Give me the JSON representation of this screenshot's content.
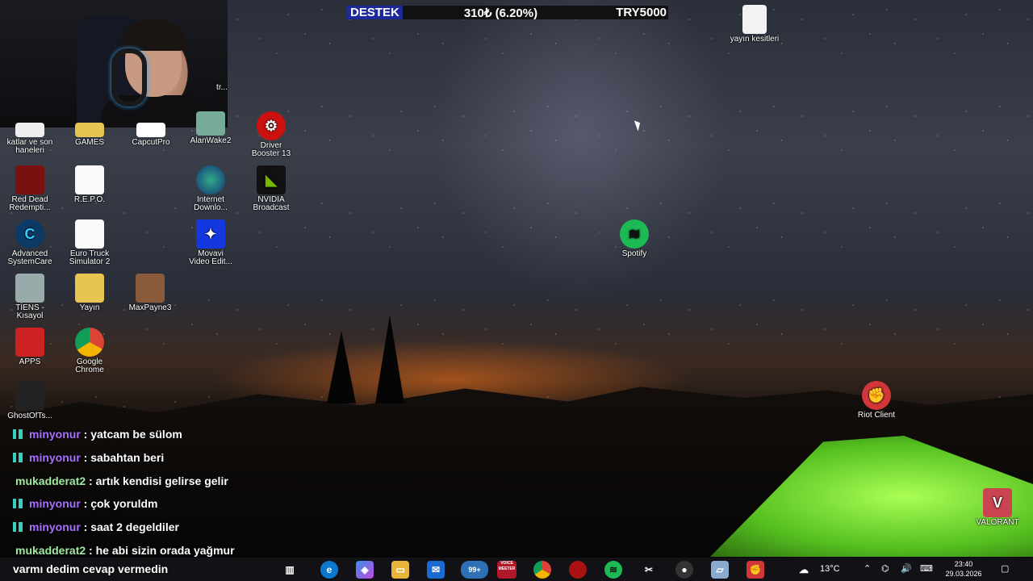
{
  "support_bar": {
    "label": "DESTEK",
    "amount": "310₺ (6.20%)",
    "goal": "TRY5000"
  },
  "desktop_icons": [
    {
      "label": "katlar ve son\nhaneleri"
    },
    {
      "label": "GAMES"
    },
    {
      "label": "CapcutPro"
    },
    {
      "label": "AlanWake2"
    },
    {
      "label": "Driver\nBooster 13"
    },
    {
      "label": "Red Dead\nRedempti..."
    },
    {
      "label": "R.E.P.O."
    },
    {
      "label": "Internet\nDownlo..."
    },
    {
      "label": "NVIDIA\nBroadcast"
    },
    {
      "label": "Advanced\nSystemCare"
    },
    {
      "label": "Euro Truck\nSimulator 2"
    },
    {
      "label": "Movavi\nVideo Edit..."
    },
    {
      "label": "TİENS -\nKısayol"
    },
    {
      "label": "Yayın"
    },
    {
      "label": "MaxPayne3"
    },
    {
      "label": "APPS"
    },
    {
      "label": "Google\nChrome"
    },
    {
      "label": "GhostOfTs..."
    },
    {
      "label": "yayın kesitleri"
    },
    {
      "label": "Spotify"
    },
    {
      "label": "Riot Client"
    },
    {
      "label": "VALORANT"
    }
  ],
  "webcam_partial_label": "tr...",
  "chat": [
    {
      "user": "minyonur",
      "text": ": yatcam be sülom",
      "type": "purple"
    },
    {
      "user": "minyonur",
      "text": ": sabahtan beri",
      "type": "purple"
    },
    {
      "user": "mukadderat2",
      "text": ": artık kendisi gelirse gelir",
      "type": "green"
    },
    {
      "user": "minyonur",
      "text": ": çok yoruldm",
      "type": "purple"
    },
    {
      "user": "minyonur",
      "text": ": saat 2 degeldiler",
      "type": "purple"
    },
    {
      "user": "mukadderat2",
      "text": ": he abi sizin orada yağmur",
      "type": "green"
    }
  ],
  "chat_continuation": "varmı dedim cevap vermedin",
  "taskbar": {
    "badge_count": "99+",
    "weather": "13°C",
    "time": "23:40",
    "date": "29.03.2026",
    "voicemeeter_label": "VOICE\nMEETER"
  }
}
